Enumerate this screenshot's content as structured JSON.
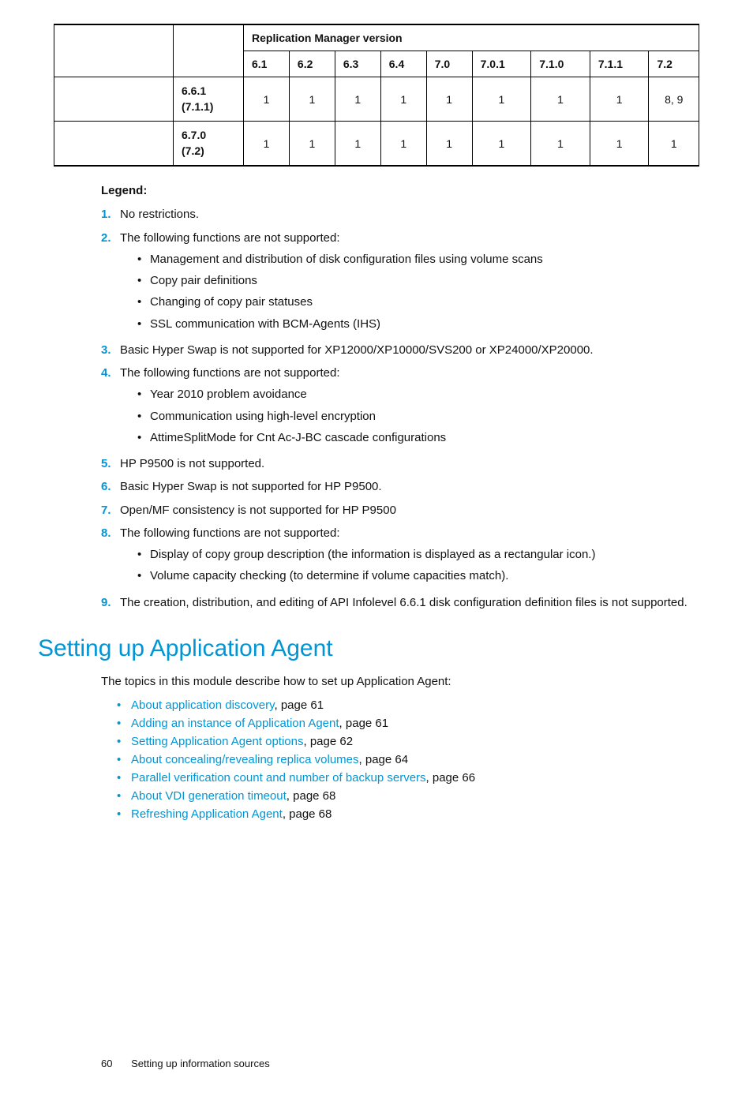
{
  "table": {
    "header_label": "Replication Manager version",
    "versions": [
      "6.1",
      "6.2",
      "6.3",
      "6.4",
      "7.0",
      "7.0.1",
      "7.1.0",
      "7.1.1",
      "7.2"
    ],
    "rows": [
      {
        "label_a": "6.6.1",
        "label_b": "(7.1.1)",
        "cells": [
          "1",
          "1",
          "1",
          "1",
          "1",
          "1",
          "1",
          "1",
          "8, 9"
        ]
      },
      {
        "label_a": "6.7.0",
        "label_b": "(7.2)",
        "cells": [
          "1",
          "1",
          "1",
          "1",
          "1",
          "1",
          "1",
          "1",
          "1"
        ]
      }
    ]
  },
  "legend": {
    "title": "Legend:",
    "items": [
      {
        "num": "1.",
        "text": "No restrictions."
      },
      {
        "num": "2.",
        "text": "The following functions are not supported:",
        "sub": [
          "Management and distribution of disk configuration files using volume scans",
          "Copy pair definitions",
          "Changing of copy pair statuses",
          "SSL communication with BCM-Agents (IHS)"
        ]
      },
      {
        "num": "3.",
        "text": "Basic Hyper Swap is not supported for XP12000/XP10000/SVS200 or XP24000/XP20000."
      },
      {
        "num": "4.",
        "text": "The following functions are not supported:",
        "sub": [
          "Year 2010 problem avoidance",
          "Communication using high-level encryption",
          "AttimeSplitMode for Cnt Ac-J-BC cascade configurations"
        ]
      },
      {
        "num": "5.",
        "text": "HP P9500 is not supported."
      },
      {
        "num": "6.",
        "text": "Basic Hyper Swap is not supported for HP P9500."
      },
      {
        "num": "7.",
        "text": "Open/MF consistency is not supported for HP P9500"
      },
      {
        "num": "8.",
        "text": "The following functions are not supported:",
        "sub": [
          "Display of copy group description (the information is displayed as a rectangular icon.)",
          "Volume capacity checking (to determine if volume capacities match)."
        ]
      },
      {
        "num": "9.",
        "text": "The creation, distribution, and editing of API Infolevel 6.6.1 disk configuration definition files is not supported."
      }
    ]
  },
  "section_heading": "Setting up Application Agent",
  "intro": "The topics in this module describe how to set up Application Agent:",
  "links": [
    {
      "title": "About application discovery",
      "page": "61"
    },
    {
      "title": "Adding an instance of Application Agent",
      "page": "61"
    },
    {
      "title": "Setting Application Agent options",
      "page": "62"
    },
    {
      "title": "About concealing/revealing replica volumes",
      "page": "64"
    },
    {
      "title": "Parallel verification count and number of backup servers",
      "page": "66"
    },
    {
      "title": "About VDI generation timeout",
      "page": "68"
    },
    {
      "title": "Refreshing Application Agent",
      "page": "68"
    }
  ],
  "footer": {
    "page": "60",
    "title": "Setting up information sources"
  }
}
